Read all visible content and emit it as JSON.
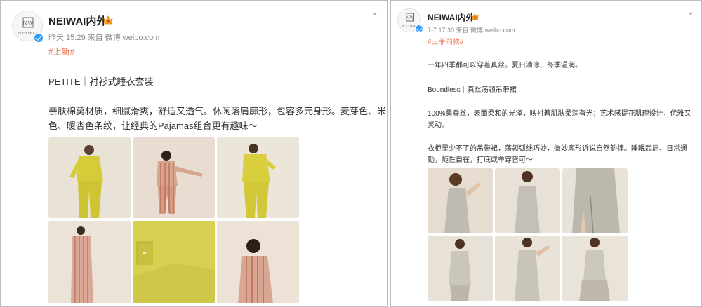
{
  "posts": [
    {
      "account_name": "NEIWAI内外",
      "avatar_monogram": "NW",
      "avatar_text": "NEIWAI",
      "timestamp": "昨天 15:29",
      "source": "来自 微博 weibo.com",
      "hashtag": "#上新#",
      "lines": [
        "PETITE｜衬衫式睡衣套装",
        "亲肤棉莫材质，细腻滑爽，舒适又透气。休闲落肩廓形，包容多元身形。麦芽色、米黄",
        "色、暖杏色条纹，让经典的Pajamas组合更有趣味～"
      ],
      "photos": [
        "yellow-pajama-front",
        "stripe-pajama-pose",
        "yellow-pajama-back",
        "stripe-pajama-side",
        "yellow-shirt-closeup",
        "stripe-pajama-portrait"
      ]
    },
    {
      "account_name": "NEIWAI内外",
      "avatar_monogram": "NW",
      "avatar_text": "NEIWAI",
      "timestamp": "7-7 17:30",
      "source": "来自 微博 weibo.com",
      "hashtag": "#王菲同款#",
      "lines": [
        "一年四季都可以穿着真丝。夏日清凉、冬季温润。",
        "Boundless｜真丝荡领吊带裙",
        "100%桑蚕丝，表面柔和的光泽，映衬着肌肤柔润有光；艺术感提花肌理设计，优雅又",
        "灵动。",
        "衣柜里少不了的吊带裙，荡领弧线巧妙，微妙廓形诉说自然韵律。睡眠起居、日常通",
        "勤，随性自在，打底或单穿皆可～"
      ],
      "photos": [
        "slip-dress-pose",
        "slip-dress-front",
        "slip-dress-slit",
        "slip-dress-back",
        "slip-dress-full",
        "slip-dress-layered"
      ]
    }
  ],
  "colors": {
    "hashtag": "#eb7350",
    "meta": "#8a8a8a",
    "verified": "#2f9bff"
  }
}
